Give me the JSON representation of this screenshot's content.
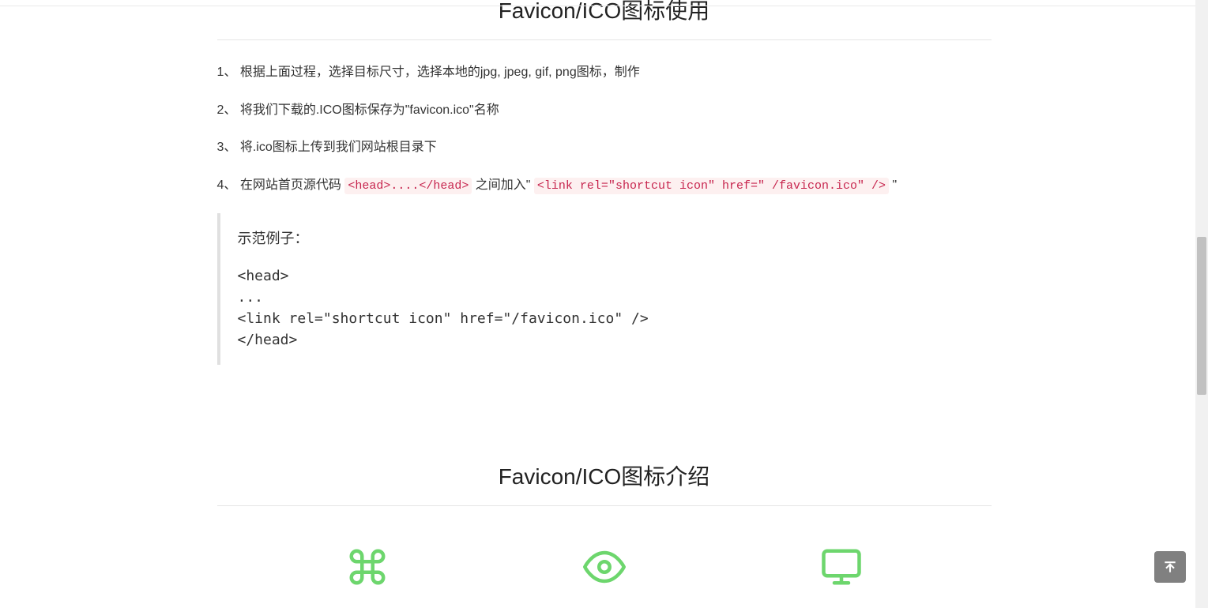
{
  "section_usage": {
    "title": "Favicon/ICO图标使用",
    "steps": [
      {
        "prefix": "1、 ",
        "text": "根据上面过程，选择目标尺寸，选择本地的jpg, jpeg, gif, png图标，制作"
      },
      {
        "prefix": "2、 ",
        "text": "将我们下载的.ICO图标保存为\"favicon.ico\"名称"
      },
      {
        "prefix": "3、 ",
        "text": "将.ico图标上传到我们网站根目录下"
      }
    ],
    "step4": {
      "prefix": "4、 ",
      "text_before_code1": "在网站首页源代码 ",
      "code1": "<head>....</head>",
      "text_mid": " 之间加入\" ",
      "code2": "<link rel=\"shortcut icon\" href=\" /favicon.ico\" />",
      "text_after": " \""
    },
    "example": {
      "label": "示范例子：",
      "lines": "<head>\n...\n<link rel=\"shortcut icon\" href=\"/favicon.ico\" />\n</head>"
    }
  },
  "section_intro": {
    "title": "Favicon/ICO图标介绍"
  }
}
